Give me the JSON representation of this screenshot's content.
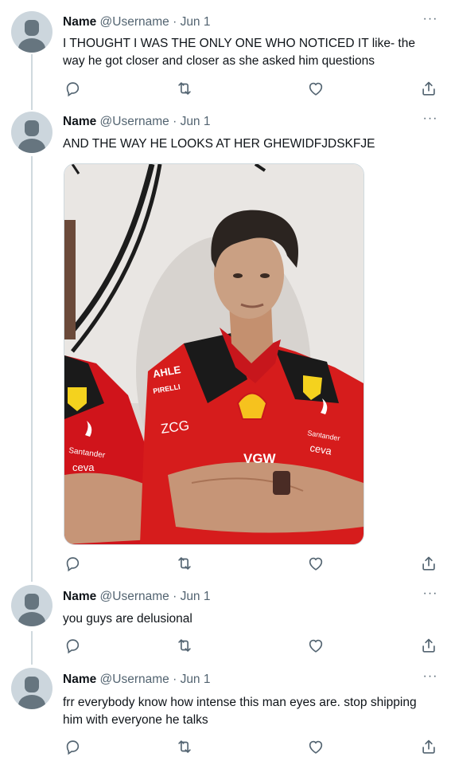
{
  "tweets": [
    {
      "name": "Name",
      "handle": "@Username",
      "date": "Jun 1",
      "text": "I THOUGHT I WAS THE ONLY ONE WHO NOTICED IT like- the way he got closer and closer as she asked him questions"
    },
    {
      "name": "Name",
      "handle": "@Username",
      "date": "Jun 1",
      "text": "AND THE WAY HE LOOKS AT HER GHEWIDFJDSKFJE",
      "media": {
        "shirt_texts": [
          "AHLE",
          "PIRELLI",
          "ZCG",
          "VGW",
          "Santander",
          "ceva",
          "Santander",
          "ceva"
        ]
      }
    },
    {
      "name": "Name",
      "handle": "@Username",
      "date": "Jun 1",
      "text": "you guys are delusional"
    },
    {
      "name": "Name",
      "handle": "@Username",
      "date": "Jun 1",
      "text": "frr everybody know how intense this man eyes are. stop shipping him with everyone he talks"
    }
  ],
  "separator": "·",
  "more_label": "···",
  "icons": [
    "reply-icon",
    "retweet-icon",
    "like-icon",
    "share-icon"
  ],
  "colors": {
    "icon": "#536471",
    "thread_line": "#cfd9de",
    "ferrari_red": "#d61c1c"
  }
}
